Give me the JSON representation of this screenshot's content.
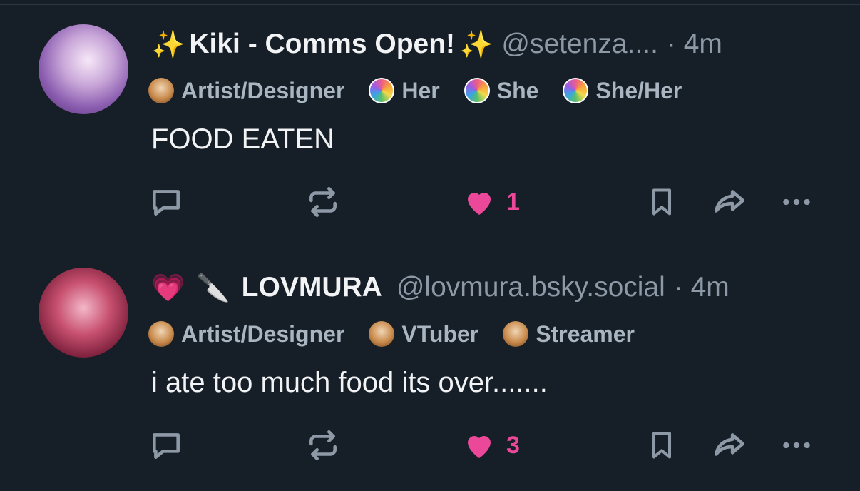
{
  "colors": {
    "background": "#161e27",
    "text": "#f1f3f5",
    "muted": "#8d99a6",
    "tag_text": "#aab5c2",
    "like": "#ec4899",
    "icon": "#8d99a6"
  },
  "posts": [
    {
      "emoji_left": "✨",
      "display_name": "Kiki - Comms Open!",
      "emoji_right": "✨",
      "handle": "@setenza....",
      "time": "· 4m",
      "tags": [
        {
          "icon": "chicken-icon",
          "label": "Artist/Designer"
        },
        {
          "icon": "pride-pronoun-icon",
          "label": "Her"
        },
        {
          "icon": "pride-pronoun-icon",
          "label": "She"
        },
        {
          "icon": "pride-pronoun-icon",
          "label": "She/Her"
        }
      ],
      "text": "FOOD EATEN",
      "like_count": "1",
      "liked": true
    },
    {
      "emoji_left": "💗",
      "emoji_right": "🔪",
      "display_name": "LOVMURA",
      "handle": "@lovmura.bsky.social",
      "time": "· 4m",
      "tags": [
        {
          "icon": "chicken-icon",
          "label": "Artist/Designer"
        },
        {
          "icon": "chicken-icon",
          "label": "VTuber"
        },
        {
          "icon": "chicken-icon",
          "label": "Streamer"
        }
      ],
      "text": "i ate too much food its over.......",
      "like_count": "3",
      "liked": true
    }
  ],
  "icons": {
    "reply": "reply-icon",
    "repost": "repost-icon",
    "like": "heart-icon",
    "bookmark": "bookmark-icon",
    "share": "share-icon",
    "more": "more-icon"
  }
}
